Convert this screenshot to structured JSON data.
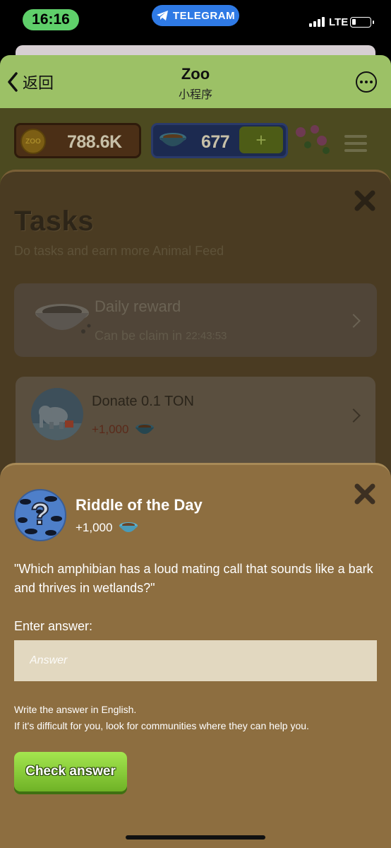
{
  "status_bar": {
    "time": "16:16",
    "app_pill": "TELEGRAM",
    "network": "LTE"
  },
  "header": {
    "back_label": "返回",
    "title": "Zoo",
    "subtitle": "小程序"
  },
  "game": {
    "coins_icon_text": "ZOO",
    "coins": "788.6K",
    "feed": "677",
    "plus_label": "+"
  },
  "tasks": {
    "title": "Tasks",
    "subtitle": "Do tasks and earn more Animal Feed",
    "items": [
      {
        "name": "Daily reward",
        "sub_label": "Can be claim in",
        "timer": "22:43:53"
      },
      {
        "name": "Donate 0.1 TON",
        "reward": "+1,000"
      }
    ]
  },
  "riddle": {
    "title": "Riddle of the Day",
    "reward": "+1,000",
    "question": "\"Which amphibian has a loud mating call that sounds like a bark and thrives in wetlands?\"",
    "answer_label": "Enter answer:",
    "answer_placeholder": "Answer",
    "hint_line1": "Write the answer in English.",
    "hint_line2": "If it's difficult for you, look for communities where they can help you.",
    "check_button": "Check answer"
  },
  "colors": {
    "header_bg": "#9cc166",
    "modal_bg": "#8d6e40",
    "button_green": "#8ccd3a",
    "reward_red": "#c0392b"
  }
}
